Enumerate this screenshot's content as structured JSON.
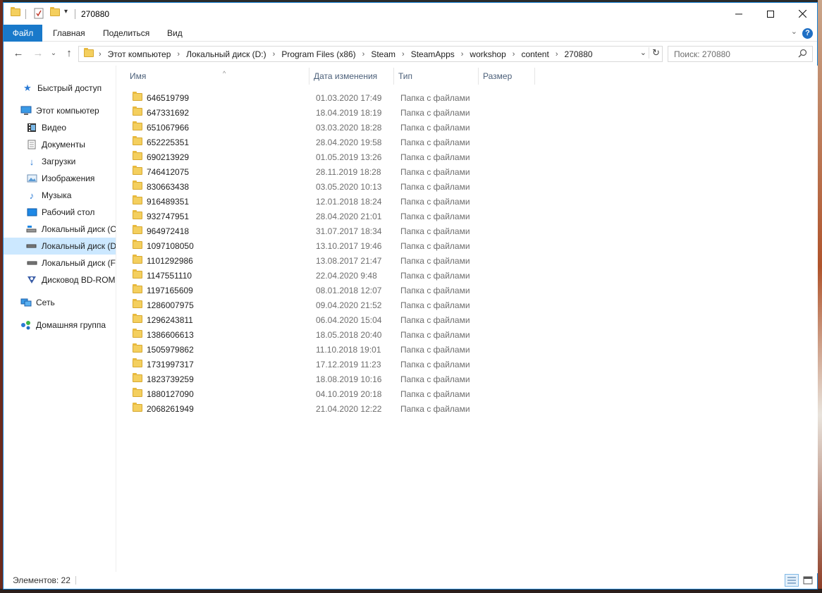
{
  "window": {
    "title": "270880"
  },
  "ribbon": {
    "tabs": [
      "Файл",
      "Главная",
      "Поделиться",
      "Вид"
    ]
  },
  "address": {
    "crumbs": [
      "Этот компьютер",
      "Локальный диск (D:)",
      "Program Files (x86)",
      "Steam",
      "SteamApps",
      "workshop",
      "content",
      "270880"
    ]
  },
  "search": {
    "placeholder": "Поиск: 270880"
  },
  "sidebar": {
    "items": [
      {
        "label": "Быстрый доступ",
        "icon": "star-icon"
      },
      {
        "label": "Этот компьютер",
        "icon": "computer-icon"
      },
      {
        "label": "Видео",
        "icon": "video-icon"
      },
      {
        "label": "Документы",
        "icon": "documents-icon"
      },
      {
        "label": "Загрузки",
        "icon": "downloads-icon"
      },
      {
        "label": "Изображения",
        "icon": "pictures-icon"
      },
      {
        "label": "Музыка",
        "icon": "music-icon"
      },
      {
        "label": "Рабочий стол",
        "icon": "desktop-icon"
      },
      {
        "label": "Локальный диск (C",
        "icon": "system-drive-icon"
      },
      {
        "label": "Локальный диск (D",
        "icon": "drive-icon",
        "selected": true
      },
      {
        "label": "Локальный диск (F",
        "icon": "drive-icon"
      },
      {
        "label": "Дисковод BD-ROM",
        "icon": "bd-rom-icon"
      },
      {
        "label": "Сеть",
        "icon": "network-icon"
      },
      {
        "label": "Домашняя группа",
        "icon": "homegroup-icon"
      }
    ]
  },
  "columns": {
    "name": "Имя",
    "date": "Дата изменения",
    "type": "Тип",
    "size": "Размер"
  },
  "files": [
    {
      "name": "646519799",
      "date": "01.03.2020 17:49",
      "type": "Папка с файлами"
    },
    {
      "name": "647331692",
      "date": "18.04.2019 18:19",
      "type": "Папка с файлами"
    },
    {
      "name": "651067966",
      "date": "03.03.2020 18:28",
      "type": "Папка с файлами"
    },
    {
      "name": "652225351",
      "date": "28.04.2020 19:58",
      "type": "Папка с файлами"
    },
    {
      "name": "690213929",
      "date": "01.05.2019 13:26",
      "type": "Папка с файлами"
    },
    {
      "name": "746412075",
      "date": "28.11.2019 18:28",
      "type": "Папка с файлами"
    },
    {
      "name": "830663438",
      "date": "03.05.2020 10:13",
      "type": "Папка с файлами"
    },
    {
      "name": "916489351",
      "date": "12.01.2018 18:24",
      "type": "Папка с файлами"
    },
    {
      "name": "932747951",
      "date": "28.04.2020 21:01",
      "type": "Папка с файлами"
    },
    {
      "name": "964972418",
      "date": "31.07.2017 18:34",
      "type": "Папка с файлами"
    },
    {
      "name": "1097108050",
      "date": "13.10.2017 19:46",
      "type": "Папка с файлами"
    },
    {
      "name": "1101292986",
      "date": "13.08.2017 21:47",
      "type": "Папка с файлами"
    },
    {
      "name": "1147551110",
      "date": "22.04.2020 9:48",
      "type": "Папка с файлами"
    },
    {
      "name": "1197165609",
      "date": "08.01.2018 12:07",
      "type": "Папка с файлами"
    },
    {
      "name": "1286007975",
      "date": "09.04.2020 21:52",
      "type": "Папка с файлами"
    },
    {
      "name": "1296243811",
      "date": "06.04.2020 15:04",
      "type": "Папка с файлами"
    },
    {
      "name": "1386606613",
      "date": "18.05.2018 20:40",
      "type": "Папка с файлами"
    },
    {
      "name": "1505979862",
      "date": "11.10.2018 19:01",
      "type": "Папка с файлами"
    },
    {
      "name": "1731997317",
      "date": "17.12.2019 11:23",
      "type": "Папка с файлами"
    },
    {
      "name": "1823739259",
      "date": "18.08.2019 10:16",
      "type": "Папка с файлами"
    },
    {
      "name": "1880127090",
      "date": "04.10.2019 20:18",
      "type": "Папка с файлами"
    },
    {
      "name": "2068261949",
      "date": "21.04.2020 12:22",
      "type": "Папка с файлами"
    }
  ],
  "status": {
    "count": "Элементов: 22"
  },
  "colors": {
    "accent": "#1979ca",
    "selection": "#cce8ff",
    "folder": "#f4cf5e"
  }
}
